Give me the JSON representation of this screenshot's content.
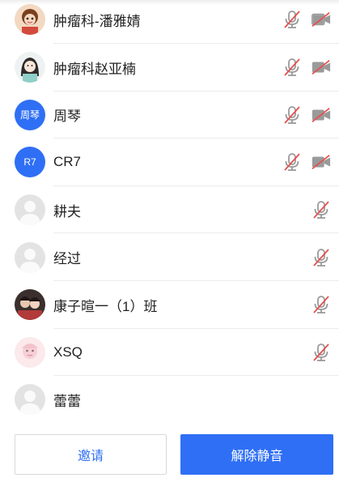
{
  "participants": [
    {
      "name": "肿瘤科-潘雅婧",
      "avatar": "photo",
      "mic": "muted",
      "video": "off"
    },
    {
      "name": "肿瘤科赵亚楠",
      "avatar": "photo",
      "mic": "muted",
      "video": "off"
    },
    {
      "name": "周琴",
      "avatar": "text",
      "avatar_text": "周琴",
      "mic": "muted",
      "video": "off"
    },
    {
      "name": "CR7",
      "avatar": "text",
      "avatar_text": "R7",
      "mic": "muted",
      "video": "off"
    },
    {
      "name": "耕夫",
      "avatar": "default",
      "mic": "muted"
    },
    {
      "name": "经过",
      "avatar": "default",
      "mic": "muted"
    },
    {
      "name": "康子暄一（1）班",
      "avatar": "photo",
      "mic": "muted"
    },
    {
      "name": "XSQ",
      "avatar": "photo",
      "mic": "muted"
    },
    {
      "name": "蕾蕾",
      "avatar": "default"
    }
  ],
  "buttons": {
    "invite": "邀请",
    "unmute_all": "解除静音"
  },
  "colors": {
    "accent": "#2f6ff5",
    "mute_red": "#e5504f",
    "icon_gray": "#9a9a9a"
  }
}
